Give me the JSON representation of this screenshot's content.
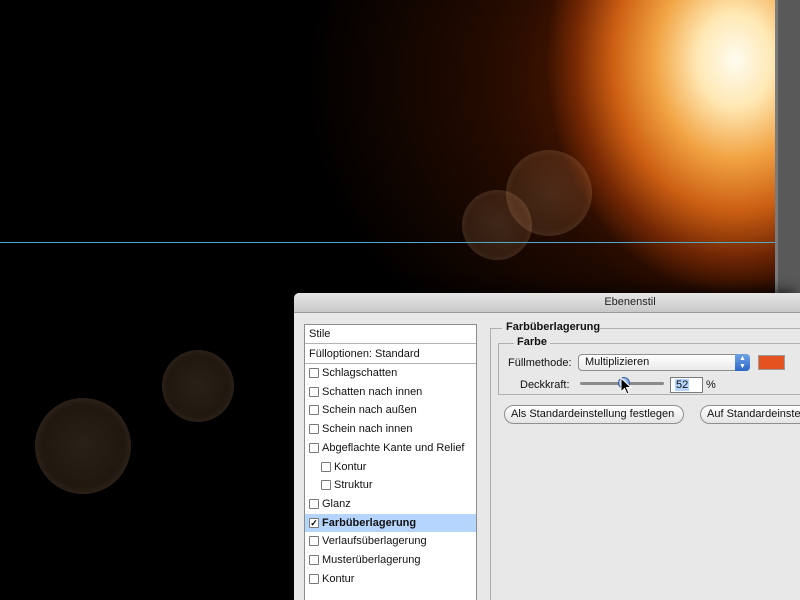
{
  "dialog": {
    "title": "Ebenenstil",
    "styles_header": "Stile",
    "blend_options": "Fülloptionen: Standard",
    "styles": [
      {
        "label": "Schlagschatten",
        "checked": false,
        "indent": false
      },
      {
        "label": "Schatten nach innen",
        "checked": false,
        "indent": false
      },
      {
        "label": "Schein nach außen",
        "checked": false,
        "indent": false
      },
      {
        "label": "Schein nach innen",
        "checked": false,
        "indent": false
      },
      {
        "label": "Abgeflachte Kante und Relief",
        "checked": false,
        "indent": false
      },
      {
        "label": "Kontur",
        "checked": false,
        "indent": true
      },
      {
        "label": "Struktur",
        "checked": false,
        "indent": true
      },
      {
        "label": "Glanz",
        "checked": false,
        "indent": false
      },
      {
        "label": "Farbüberlagerung",
        "checked": true,
        "indent": false,
        "selected": true
      },
      {
        "label": "Verlaufsüberlagerung",
        "checked": false,
        "indent": false
      },
      {
        "label": "Musterüberlagerung",
        "checked": false,
        "indent": false
      },
      {
        "label": "Kontur",
        "checked": false,
        "indent": false
      }
    ],
    "group_title": "Farbüberlagerung",
    "farbe_label": "Farbe",
    "blend_mode_label": "Füllmethode:",
    "blend_mode_value": "Multiplizieren",
    "overlay_color": "#e4521f",
    "opacity_label": "Deckkraft:",
    "opacity_value": "52",
    "opacity_unit": "%",
    "opacity_fraction": 0.52,
    "set_default_button": "Als Standardeinstellung festlegen",
    "reset_default_button": "Auf Standardeinstellung zurücksetzen"
  },
  "icons": {
    "blend_arrows": "up-down-arrows-icon",
    "checkmark": "checkmark-icon",
    "cursor": "mouse-pointer-icon"
  },
  "colors": {
    "selection": "#b5d5ff",
    "guide": "#4fa9c9",
    "dialog_bg": "#e8e8e8"
  }
}
